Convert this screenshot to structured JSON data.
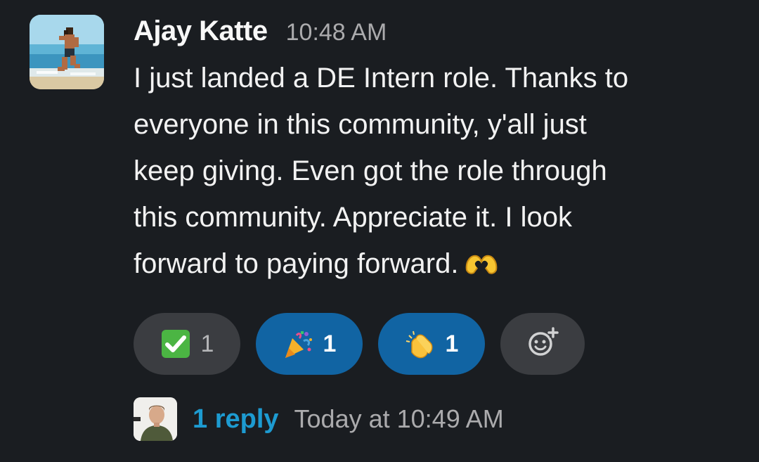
{
  "message": {
    "author": "Ajay Katte",
    "time": "10:48 AM",
    "lines": [
      "I just landed a DE Intern role. Thanks to",
      "everyone in this community, y'all just",
      "keep giving. Even got the role through",
      "this community. Appreciate it. I look",
      "forward to paying forward."
    ],
    "trailing_emoji": "heart-hands"
  },
  "reactions": [
    {
      "emoji": "white-check-mark",
      "count": "1",
      "active": false
    },
    {
      "emoji": "tada",
      "count": "1",
      "active": true
    },
    {
      "emoji": "clap",
      "count": "1",
      "active": true
    }
  ],
  "add_reaction": {
    "icon": "add-reaction-icon"
  },
  "thread": {
    "reply_count": "1 reply",
    "last_reply": "Today at 10:49 AM"
  },
  "colors": {
    "background": "#1a1d21",
    "link": "#1d9bd1",
    "active_reaction": "#1164a3",
    "neutral_reaction": "#3b3d41"
  }
}
